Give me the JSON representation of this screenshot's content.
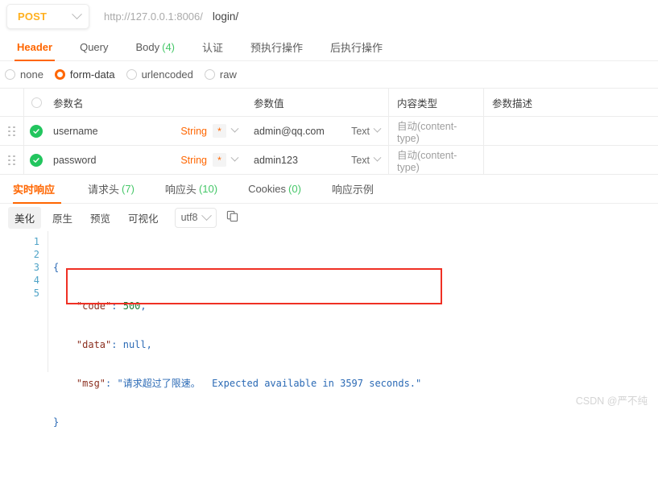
{
  "urlbar": {
    "method": "POST",
    "method_caret": "chevron-down-icon",
    "host": "http://127.0.0.1:8006/",
    "path": "login/"
  },
  "request_tabs": [
    {
      "label": "Header",
      "count": "",
      "active": false
    },
    {
      "label": "Query",
      "count": "",
      "active": false
    },
    {
      "label": "Body",
      "count": "(4)",
      "active": true
    },
    {
      "label": "认证",
      "count": "",
      "active": false
    },
    {
      "label": "预执行操作",
      "count": "",
      "active": false
    },
    {
      "label": "后执行操作",
      "count": "",
      "active": false
    }
  ],
  "body_type": {
    "options": [
      {
        "label": "none",
        "selected": false
      },
      {
        "label": "form-data",
        "selected": true
      },
      {
        "label": "urlencoded",
        "selected": false
      },
      {
        "label": "raw",
        "selected": false
      }
    ]
  },
  "param_table": {
    "headers": {
      "name": "参数名",
      "value": "参数值",
      "content_type": "内容类型",
      "description": "参数描述"
    },
    "rows": [
      {
        "enabled": true,
        "name": "username",
        "type": "String",
        "required_mark": "*",
        "value": "admin@qq.com",
        "value_type": "Text",
        "content_type": "自动(content-type)",
        "description": ""
      },
      {
        "enabled": true,
        "name": "password",
        "type": "String",
        "required_mark": "*",
        "value": "admin123",
        "value_type": "Text",
        "content_type": "自动(content-type)",
        "description": ""
      }
    ]
  },
  "response_tabs": [
    {
      "label": "实时响应",
      "count": "",
      "active": true
    },
    {
      "label": "请求头",
      "count": "(7)",
      "active": false
    },
    {
      "label": "响应头",
      "count": "(10)",
      "active": false
    },
    {
      "label": "Cookies",
      "count": "(0)",
      "active": false
    },
    {
      "label": "响应示例",
      "count": "",
      "active": false
    }
  ],
  "response_toolbar": {
    "views": [
      {
        "label": "美化",
        "selected": true
      },
      {
        "label": "原生",
        "selected": false
      },
      {
        "label": "预览",
        "selected": false
      },
      {
        "label": "可视化",
        "selected": false
      }
    ],
    "encoding": "utf8",
    "encoding_caret": "chevron-down-icon",
    "copy_icon": "copy-icon"
  },
  "response_body": {
    "line_numbers": [
      "1",
      "2",
      "3",
      "4",
      "5"
    ],
    "json": {
      "code": 500,
      "data": null,
      "msg": "请求超过了限速。  Expected available in 3597 seconds."
    },
    "lines": [
      {
        "indent": 0,
        "text": "{"
      },
      {
        "indent": 1,
        "text": "\"code\": 500,"
      },
      {
        "indent": 1,
        "text": "\"data\": null,"
      },
      {
        "indent": 1,
        "text": "\"msg\": \"请求超过了限速。  Expected available in 3597 seconds.\""
      },
      {
        "indent": 0,
        "text": "}"
      }
    ],
    "highlight_box": {
      "color": "#ef3024"
    }
  },
  "watermark": "CSDN @严不纯",
  "colors": {
    "accent_orange": "#FF6600",
    "method_amber": "#FFB01F",
    "count_green": "#44c767",
    "check_green": "#22c55e",
    "error_red": "#ef3024",
    "json_string_blue": "#2b6ab5",
    "json_key_maroon": "#8b2f1f",
    "json_number_green": "#1a7f37"
  }
}
